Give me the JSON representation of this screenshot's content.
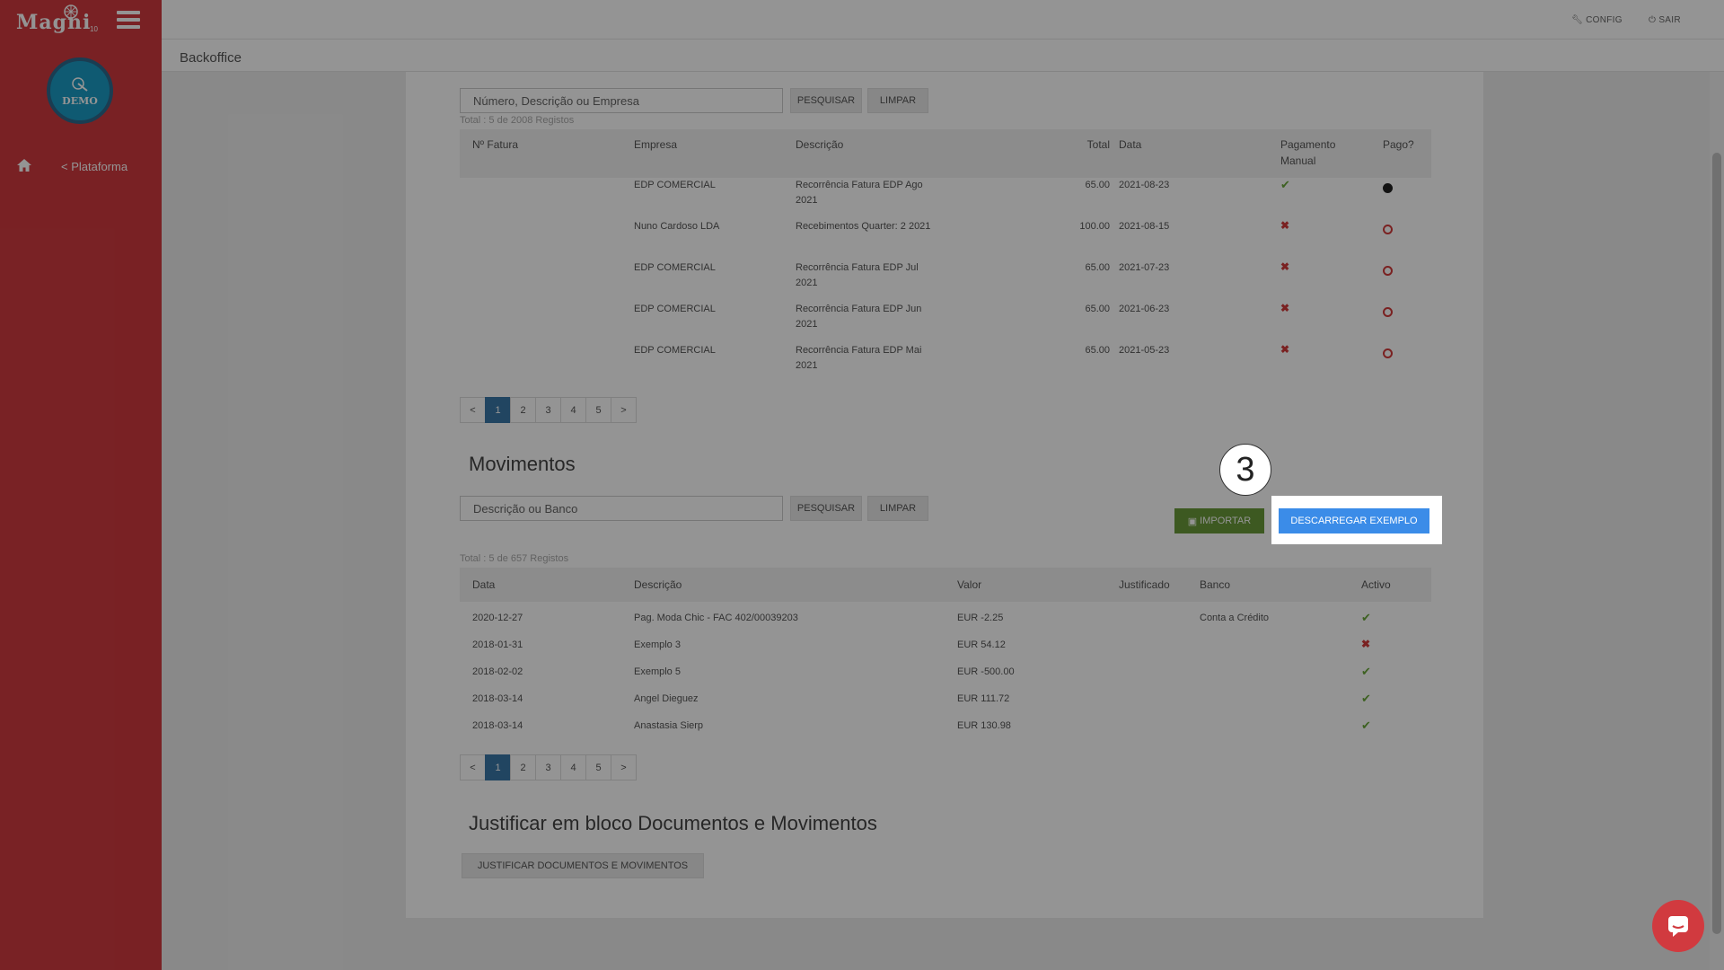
{
  "app": {
    "logo": "Magni",
    "version": "10",
    "avatar_label": "DEMO"
  },
  "sidebar": {
    "plataforma_label": "< Plataforma"
  },
  "topbar": {
    "config_label": "CONFIG",
    "sair_label": "SAIR"
  },
  "page": {
    "title": "Backoffice"
  },
  "faturas": {
    "search_placeholder": "Número, Descrição ou Empresa",
    "search_button": "PESQUISAR",
    "clear_button": "LIMPAR",
    "total": "Total : 5 de 2008 Registos",
    "headers": [
      "Nº Fatura",
      "Empresa",
      "Descrição",
      "Total",
      "Data",
      "Pagamento Manual",
      "Pago?"
    ],
    "rows": [
      {
        "empresa": "EDP COMERCIAL",
        "descricao": "Recorrência Fatura EDP Ago 2021",
        "total": "65.00",
        "data": "2021-08-23",
        "manual": true,
        "pago": true
      },
      {
        "empresa": "Nuno Cardoso LDA",
        "descricao": "Recebimentos Quarter: 2 2021",
        "total": "100.00",
        "data": "2021-08-15",
        "manual": false,
        "pago": false
      },
      {
        "empresa": "EDP COMERCIAL",
        "descricao": "Recorrência Fatura EDP Jul 2021",
        "total": "65.00",
        "data": "2021-07-23",
        "manual": false,
        "pago": false
      },
      {
        "empresa": "EDP COMERCIAL",
        "descricao": "Recorrência Fatura EDP Jun 2021",
        "total": "65.00",
        "data": "2021-06-23",
        "manual": false,
        "pago": false
      },
      {
        "empresa": "EDP COMERCIAL",
        "descricao": "Recorrência Fatura EDP Mai 2021",
        "total": "65.00",
        "data": "2021-05-23",
        "manual": false,
        "pago": false
      }
    ],
    "pages": [
      "<",
      "1",
      "2",
      "3",
      "4",
      "5",
      ">"
    ]
  },
  "movimentos": {
    "title": "Movimentos",
    "search_placeholder": "Descrição ou Banco",
    "search_button": "PESQUISAR",
    "clear_button": "LIMPAR",
    "import_button": "IMPORTAR",
    "download_button": "DESCARREGAR EXEMPLO",
    "total": "Total : 5 de 657 Registos",
    "headers": [
      "Data",
      "Descrição",
      "Valor",
      "Justificado",
      "Banco",
      "Activo"
    ],
    "rows": [
      {
        "data": "2020-12-27",
        "descricao": "Pag. Moda Chic - FAC 402/00039203",
        "valor": "EUR -2.25",
        "banco": "Conta a Crédito",
        "activo": true
      },
      {
        "data": "2018-01-31",
        "descricao": "Exemplo 3",
        "valor": "EUR 54.12",
        "banco": "",
        "activo": false
      },
      {
        "data": "2018-02-02",
        "descricao": "Exemplo 5",
        "valor": "EUR -500.00",
        "banco": "",
        "activo": true
      },
      {
        "data": "2018-03-14",
        "descricao": "Angel Dieguez",
        "valor": "EUR 111.72",
        "banco": "",
        "activo": true
      },
      {
        "data": "2018-03-14",
        "descricao": "Anastasia Sierp",
        "valor": "EUR 130.98",
        "banco": "",
        "activo": true
      }
    ],
    "pages": [
      "<",
      "1",
      "2",
      "3",
      "4",
      "5",
      ">"
    ]
  },
  "bloco": {
    "title": "Justificar em bloco Documentos e Movimentos",
    "button": "JUSTIFICAR DOCUMENTOS E MOVIMENTOS"
  },
  "tutorial": {
    "step_number": "3"
  },
  "colors": {
    "sidebar": "#d13a3f",
    "active_page": "#3a78a8",
    "import": "#6a9a3a",
    "download": "#3b8ce8"
  }
}
